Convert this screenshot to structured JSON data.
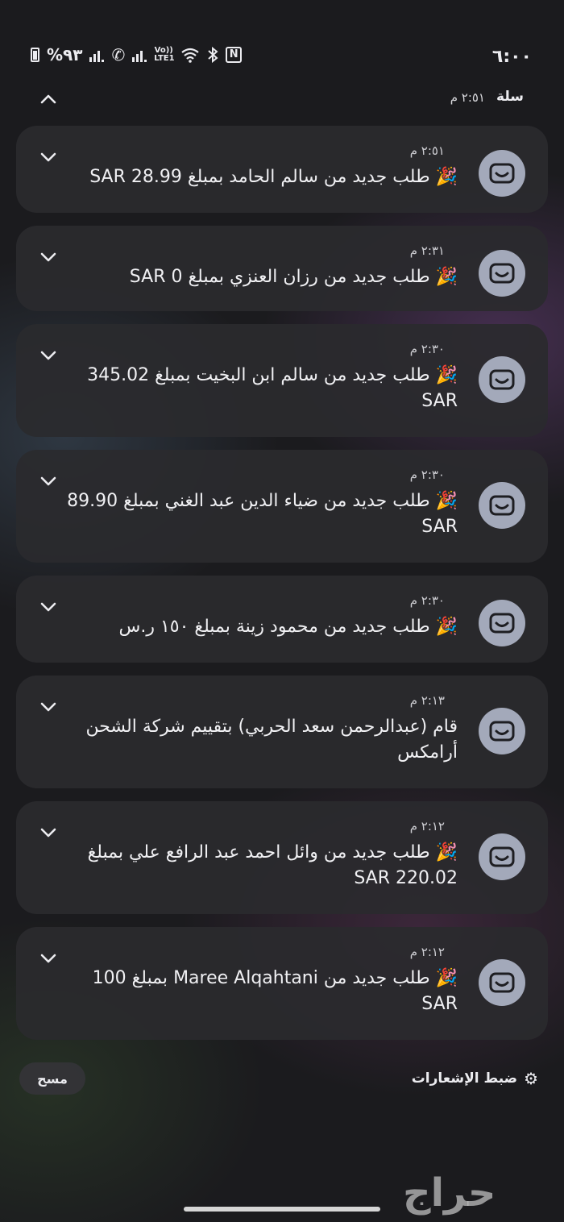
{
  "status_bar": {
    "time": "٦:٠٠",
    "battery": "%٩٣",
    "volte_label": "Vo)) LTE1",
    "icons": [
      "battery-icon",
      "signal-icon",
      "wifi-calling-icon",
      "signal-icon",
      "volte-icon",
      "wifi-icon",
      "bluetooth-icon",
      "nfc-icon"
    ]
  },
  "header": {
    "app_name": "سلة",
    "time": "٢:٥١ م",
    "collapse_icon": "chevron-up-icon"
  },
  "notifications": [
    {
      "time": "٢:٥١ م",
      "text": "🎉 طلب جديد من سالم الحامد بمبلغ 28.99 SAR"
    },
    {
      "time": "٢:٣١ م",
      "text": "🎉 طلب جديد من رزان العنزي بمبلغ 0 SAR"
    },
    {
      "time": "٢:٣٠ م",
      "text": "🎉 طلب جديد من سالم ابن البخيت بمبلغ 345.02 SAR"
    },
    {
      "time": "٢:٣٠ م",
      "text": "🎉 طلب جديد من ضياء الدين عبد الغني بمبلغ 89.90 SAR"
    },
    {
      "time": "٢:٣٠ م",
      "text": "🎉 طلب جديد من محمود زينة بمبلغ ١٥٠ ر.س"
    },
    {
      "time": "٢:١٣ م",
      "text": "قام (عبدالرحمن سعد الحربي) بتقييم شركة الشحن أرامكس"
    },
    {
      "time": "٢:١٢ م",
      "text": "🎉 طلب جديد من وائل احمد عبد الرافع علي بمبلغ SAR 220.02"
    },
    {
      "time": "٢:١٢ م",
      "text": "🎉 طلب جديد من Maree Alqahtani بمبلغ 100 SAR"
    }
  ],
  "footer": {
    "settings_label": "ضبط الإشعارات",
    "clear_label": "مسح"
  },
  "watermark": "حراج",
  "colors": {
    "background": "#1b1b1e",
    "card": "#2a2a2e",
    "avatar": "#a3a9ba",
    "text": "#ececf0"
  }
}
